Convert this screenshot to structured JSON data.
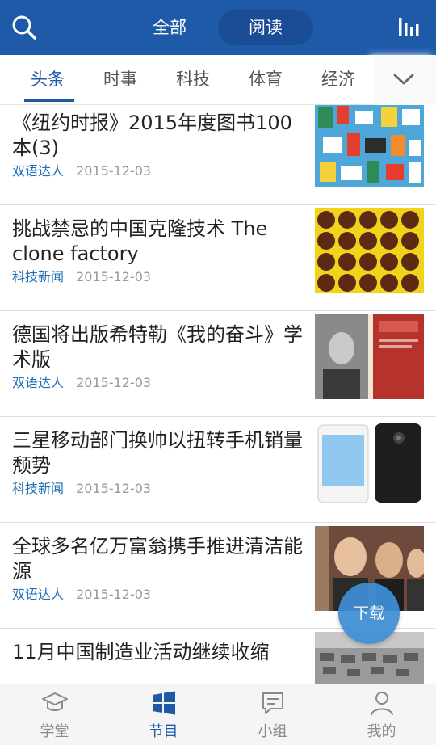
{
  "header": {
    "tabs": [
      {
        "label": "全部",
        "active": false
      },
      {
        "label": "阅读",
        "active": true
      }
    ],
    "search_icon": "search-icon",
    "right_icon": "bar-chart-icon",
    "bg_color": "#1f5aa9"
  },
  "categories": {
    "items": [
      "头条",
      "时事",
      "科技",
      "体育",
      "经济"
    ],
    "active_index": 0,
    "more_icon": "chevron-down-icon"
  },
  "feed": {
    "items": [
      {
        "title": "《纽约时报》2015年度图书100本(3)",
        "source": "双语达人",
        "date": "2015-12-03"
      },
      {
        "title": "挑战禁忌的中国克隆技术 The clone factory",
        "source": "科技新闻",
        "date": "2015-12-03"
      },
      {
        "title": "德国将出版希特勒《我的奋斗》学术版",
        "source": "双语达人",
        "date": "2015-12-03"
      },
      {
        "title": "三星移动部门换帅以扭转手机销量颓势",
        "source": "科技新闻",
        "date": "2015-12-03"
      },
      {
        "title": "全球多名亿万富翁携手推进清洁能源",
        "source": "双语达人",
        "date": "2015-12-03"
      },
      {
        "title": "11月中国制造业活动继续收缩",
        "source": "",
        "date": ""
      }
    ]
  },
  "download_fab": {
    "label": "下载"
  },
  "bottom_nav": {
    "items": [
      {
        "label": "学堂",
        "icon": "graduation-cap-icon"
      },
      {
        "label": "节目",
        "icon": "windows-tiles-icon"
      },
      {
        "label": "小组",
        "icon": "chat-bubble-icon"
      },
      {
        "label": "我的",
        "icon": "person-icon"
      }
    ],
    "active_index": 1,
    "accent_color": "#1f5aa9"
  }
}
